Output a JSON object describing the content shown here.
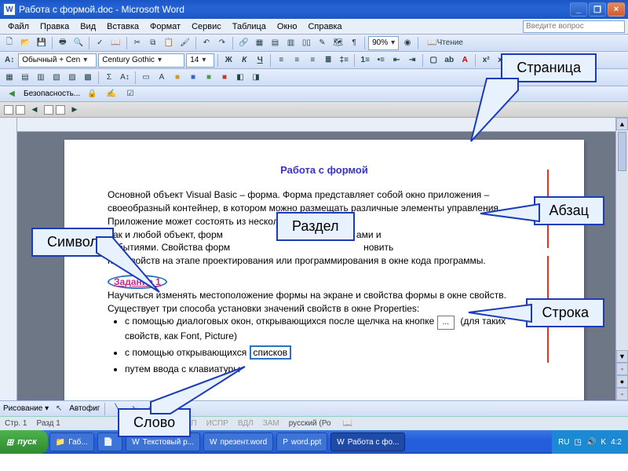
{
  "title": "Работа с формой.doc - Microsoft Word",
  "menu": [
    "Файл",
    "Правка",
    "Вид",
    "Вставка",
    "Формат",
    "Сервис",
    "Таблица",
    "Окно",
    "Справка"
  ],
  "ask_placeholder": "Введите вопрос",
  "style_combo": "Обычный + Cen",
  "font_combo": "Century Gothic",
  "size_combo": "14",
  "zoom": "90%",
  "reading": "Чтение",
  "security": "Безопасность...",
  "doc": {
    "heading": "Работа с формой",
    "p1": "Основной объект Visual Basic – форма. Форма представляет собой окно приложения – своеобразный контейнер, в котором можно размещать различные элементы управления. Приложение может состоять из нескольких форм",
    "p2a": "Как и любой объект, форм",
    "p2b": "ами и",
    "p3a": "событиями. Свойства форм",
    "p3b": "новить",
    "p4": "ние свойств на этапе проектирования или программирования в окне кода программы.",
    "task_label": "Задание 1",
    "p5": "Научиться изменять местоположение формы на экране и свойства формы в окне свойств. Существует три способа установки значений свойств в окне Properties:",
    "li1a": "с помощью диалоговых окон, открывающихся после щелчка на кнопке ",
    "li1b": " (для таких свойств, как Font, Picture)",
    "li2a": "с помощью открывающихся ",
    "li2b": "списков",
    "li3": "путем ввода с клавиатуры",
    "ellipsis": "..."
  },
  "drawbar_label": "Рисование",
  "drawbar_autofig": "Автофиг",
  "status": {
    "page": "Стр. 1",
    "section": "Разд 1",
    "rec": "ЗАП",
    "fix": "ИСПР",
    "ext": "ВДЛ",
    "ovr": "ЗАМ",
    "lang": "русский (Ро"
  },
  "taskbar": {
    "start": "пуск",
    "items": [
      "Габ...",
      "",
      "Текстовый р...",
      "презент.word",
      "word.ppt",
      "Работа с фо..."
    ],
    "tray": {
      "lang": "RU",
      "time": "4:2"
    }
  },
  "callouts": {
    "page": "Страница",
    "section": "Раздел",
    "symbol": "Символ",
    "paragraph": "Абзац",
    "line": "Строка",
    "word": "Слово"
  }
}
